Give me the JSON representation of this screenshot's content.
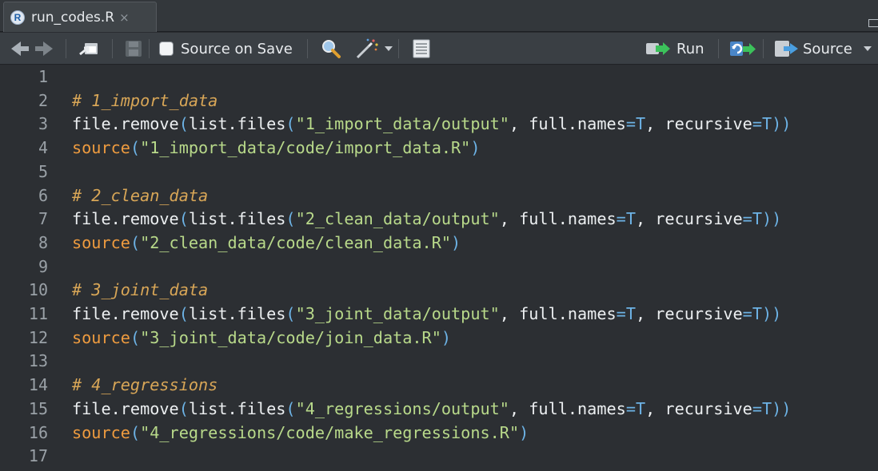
{
  "tab": {
    "badge": "R",
    "title": "run_codes.R",
    "close": "×"
  },
  "toolbar": {
    "source_on_save": "Source on Save",
    "run": "Run",
    "source": "Source"
  },
  "editor": {
    "line_numbers": [
      "1",
      "2",
      "3",
      "4",
      "5",
      "6",
      "7",
      "8",
      "9",
      "10",
      "11",
      "12",
      "13",
      "14",
      "15",
      "16",
      "17"
    ],
    "lines": [
      [],
      [
        {
          "t": "# 1_import_data",
          "k": "comment"
        }
      ],
      [
        {
          "t": "file.remove",
          "k": "fn"
        },
        {
          "t": "(",
          "k": "paren"
        },
        {
          "t": "list.files",
          "k": "fn"
        },
        {
          "t": "(",
          "k": "paren"
        },
        {
          "t": "\"1_import_data/output\"",
          "k": "str"
        },
        {
          "t": ", full.names",
          "k": "plain"
        },
        {
          "t": "=",
          "k": "op"
        },
        {
          "t": "T",
          "k": "const"
        },
        {
          "t": ", recursive",
          "k": "plain"
        },
        {
          "t": "=",
          "k": "op"
        },
        {
          "t": "T",
          "k": "const"
        },
        {
          "t": "))",
          "k": "paren"
        }
      ],
      [
        {
          "t": "source",
          "k": "src"
        },
        {
          "t": "(",
          "k": "paren"
        },
        {
          "t": "\"1_import_data/code/import_data.R\"",
          "k": "str"
        },
        {
          "t": ")",
          "k": "paren"
        }
      ],
      [],
      [
        {
          "t": "# 2_clean_data",
          "k": "comment"
        }
      ],
      [
        {
          "t": "file.remove",
          "k": "fn"
        },
        {
          "t": "(",
          "k": "paren"
        },
        {
          "t": "list.files",
          "k": "fn"
        },
        {
          "t": "(",
          "k": "paren"
        },
        {
          "t": "\"2_clean_data/output\"",
          "k": "str"
        },
        {
          "t": ", full.names",
          "k": "plain"
        },
        {
          "t": "=",
          "k": "op"
        },
        {
          "t": "T",
          "k": "const"
        },
        {
          "t": ", recursive",
          "k": "plain"
        },
        {
          "t": "=",
          "k": "op"
        },
        {
          "t": "T",
          "k": "const"
        },
        {
          "t": "))",
          "k": "paren"
        }
      ],
      [
        {
          "t": "source",
          "k": "src"
        },
        {
          "t": "(",
          "k": "paren"
        },
        {
          "t": "\"2_clean_data/code/clean_data.R\"",
          "k": "str"
        },
        {
          "t": ")",
          "k": "paren"
        }
      ],
      [],
      [
        {
          "t": "# 3_joint_data",
          "k": "comment"
        }
      ],
      [
        {
          "t": "file.remove",
          "k": "fn"
        },
        {
          "t": "(",
          "k": "paren"
        },
        {
          "t": "list.files",
          "k": "fn"
        },
        {
          "t": "(",
          "k": "paren"
        },
        {
          "t": "\"3_joint_data/output\"",
          "k": "str"
        },
        {
          "t": ", full.names",
          "k": "plain"
        },
        {
          "t": "=",
          "k": "op"
        },
        {
          "t": "T",
          "k": "const"
        },
        {
          "t": ", recursive",
          "k": "plain"
        },
        {
          "t": "=",
          "k": "op"
        },
        {
          "t": "T",
          "k": "const"
        },
        {
          "t": "))",
          "k": "paren"
        }
      ],
      [
        {
          "t": "source",
          "k": "src"
        },
        {
          "t": "(",
          "k": "paren"
        },
        {
          "t": "\"3_joint_data/code/join_data.R\"",
          "k": "str"
        },
        {
          "t": ")",
          "k": "paren"
        }
      ],
      [],
      [
        {
          "t": "# 4_regressions",
          "k": "comment"
        }
      ],
      [
        {
          "t": "file.remove",
          "k": "fn"
        },
        {
          "t": "(",
          "k": "paren"
        },
        {
          "t": "list.files",
          "k": "fn"
        },
        {
          "t": "(",
          "k": "paren"
        },
        {
          "t": "\"4_regressions/output\"",
          "k": "str"
        },
        {
          "t": ", full.names",
          "k": "plain"
        },
        {
          "t": "=",
          "k": "op"
        },
        {
          "t": "T",
          "k": "const"
        },
        {
          "t": ", recursive",
          "k": "plain"
        },
        {
          "t": "=",
          "k": "op"
        },
        {
          "t": "T",
          "k": "const"
        },
        {
          "t": "))",
          "k": "paren"
        }
      ],
      [
        {
          "t": "source",
          "k": "src"
        },
        {
          "t": "(",
          "k": "paren"
        },
        {
          "t": "\"4_regressions/code/make_regressions.R\"",
          "k": "str"
        },
        {
          "t": ")",
          "k": "paren"
        }
      ],
      []
    ]
  },
  "colors": {
    "comment": "#d8a657",
    "string": "#b8d98a",
    "paren": "#6db3e6",
    "source_fn": "#ee9b3f",
    "editor_bg": "#2c2f33"
  },
  "icons": [
    "back-arrow-icon",
    "forward-arrow-icon",
    "show-in-window-icon",
    "save-icon",
    "find-icon",
    "code-tools-wand-icon",
    "compile-report-icon",
    "run-icon",
    "rerun-icon",
    "source-icon"
  ]
}
